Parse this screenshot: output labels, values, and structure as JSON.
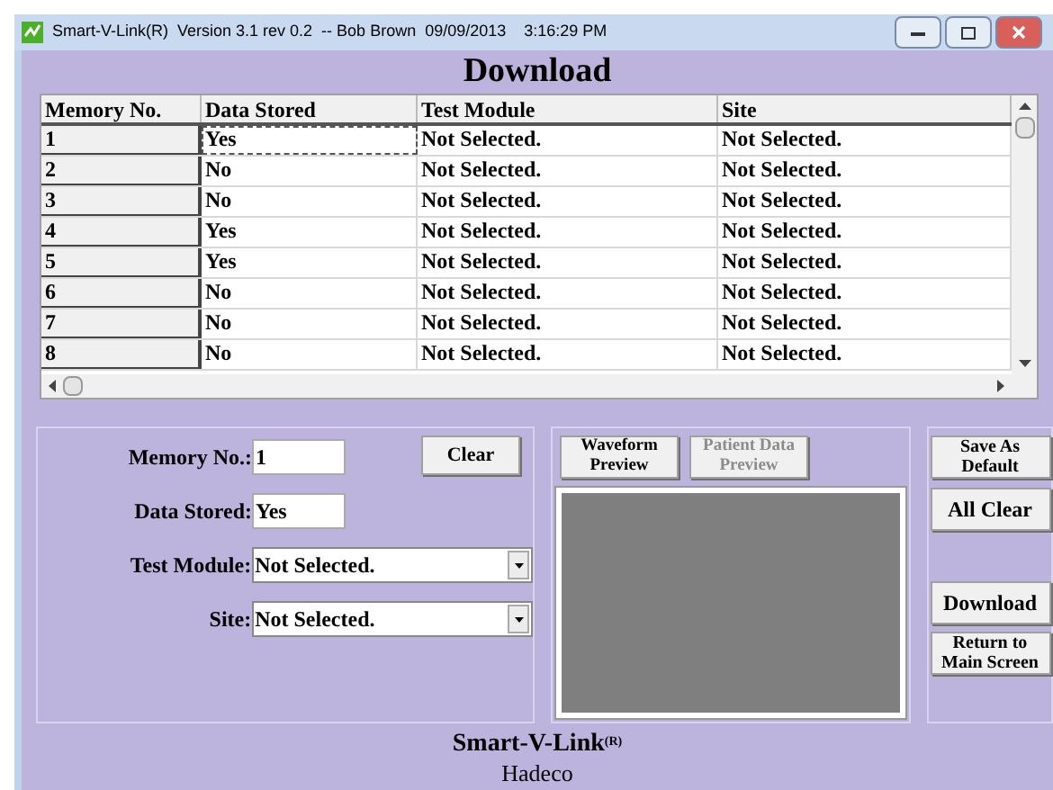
{
  "window": {
    "title": "Smart-V-Link(R)  Version 3.1 rev 0.2  -- Bob Brown  09/09/2013    3:16:29 PM"
  },
  "heading": "Download",
  "table": {
    "columns": [
      "Memory No.",
      "Data Stored",
      "Test Module",
      "Site"
    ],
    "rows": [
      {
        "cells": [
          "1",
          "Yes",
          "Not Selected.",
          "Not Selected."
        ],
        "selected": true
      },
      {
        "cells": [
          "2",
          "No",
          "Not Selected.",
          "Not Selected."
        ],
        "selected": false
      },
      {
        "cells": [
          "3",
          "No",
          "Not Selected.",
          "Not Selected."
        ],
        "selected": false
      },
      {
        "cells": [
          "4",
          "Yes",
          "Not Selected.",
          "Not Selected."
        ],
        "selected": false
      },
      {
        "cells": [
          "5",
          "Yes",
          "Not Selected.",
          "Not Selected."
        ],
        "selected": false
      },
      {
        "cells": [
          "6",
          "No",
          "Not Selected.",
          "Not Selected."
        ],
        "selected": false
      },
      {
        "cells": [
          "7",
          "No",
          "Not Selected.",
          "Not Selected."
        ],
        "selected": false
      },
      {
        "cells": [
          "8",
          "No",
          "Not Selected.",
          "Not Selected."
        ],
        "selected": false
      }
    ]
  },
  "form": {
    "fields": [
      {
        "label": "Memory No.:",
        "value": "1",
        "kind": "text"
      },
      {
        "label": "Data Stored:",
        "value": "Yes",
        "kind": "text"
      },
      {
        "label": "Test Module:",
        "value": "Not Selected.",
        "kind": "dropdown"
      },
      {
        "label": "Site:",
        "value": "Not Selected.",
        "kind": "dropdown"
      }
    ],
    "clear_button": "Clear"
  },
  "preview": {
    "buttons": [
      {
        "label": "Waveform Preview",
        "disabled": false
      },
      {
        "label": "Patient Data Preview",
        "disabled": true
      }
    ]
  },
  "actions": [
    {
      "label": "Save As Default",
      "kind": "small"
    },
    {
      "label": "All Clear",
      "kind": "large"
    },
    {
      "label": "Download",
      "kind": "large"
    },
    {
      "label": "Return to Main Screen",
      "kind": "small"
    }
  ],
  "footer": {
    "product": "Smart-V-Link$^{(R)}$",
    "company": "Hadeco"
  }
}
